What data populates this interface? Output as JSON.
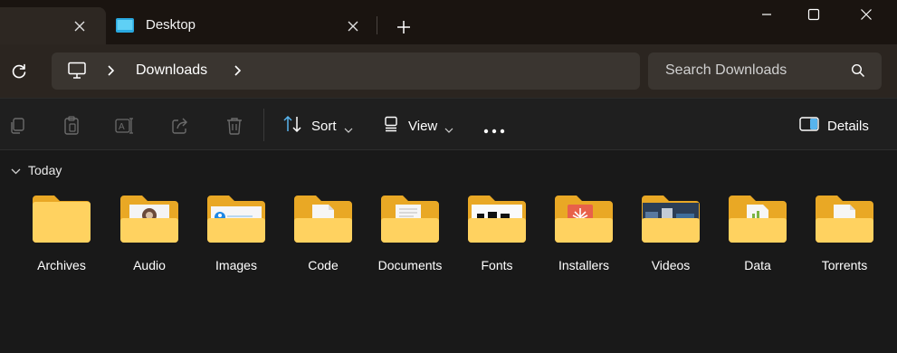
{
  "tabs": {
    "active_label": "Desktop"
  },
  "window": {
    "new_tab_label": "+"
  },
  "address": {
    "crumb": "Downloads"
  },
  "search": {
    "placeholder": "Search Downloads"
  },
  "commands": {
    "sort_label": "Sort",
    "view_label": "View",
    "more_label": "•••",
    "details_label": "Details"
  },
  "group": {
    "label": "Today"
  },
  "folders": [
    {
      "name": "Archives"
    },
    {
      "name": "Audio"
    },
    {
      "name": "Images"
    },
    {
      "name": "Code"
    },
    {
      "name": "Documents"
    },
    {
      "name": "Fonts"
    },
    {
      "name": "Installers"
    },
    {
      "name": "Videos"
    },
    {
      "name": "Data"
    },
    {
      "name": "Torrents"
    }
  ],
  "colors": {
    "folder_back": "#f0b429",
    "folder_front": "#ffd66b",
    "accent": "#4fc3f7"
  }
}
